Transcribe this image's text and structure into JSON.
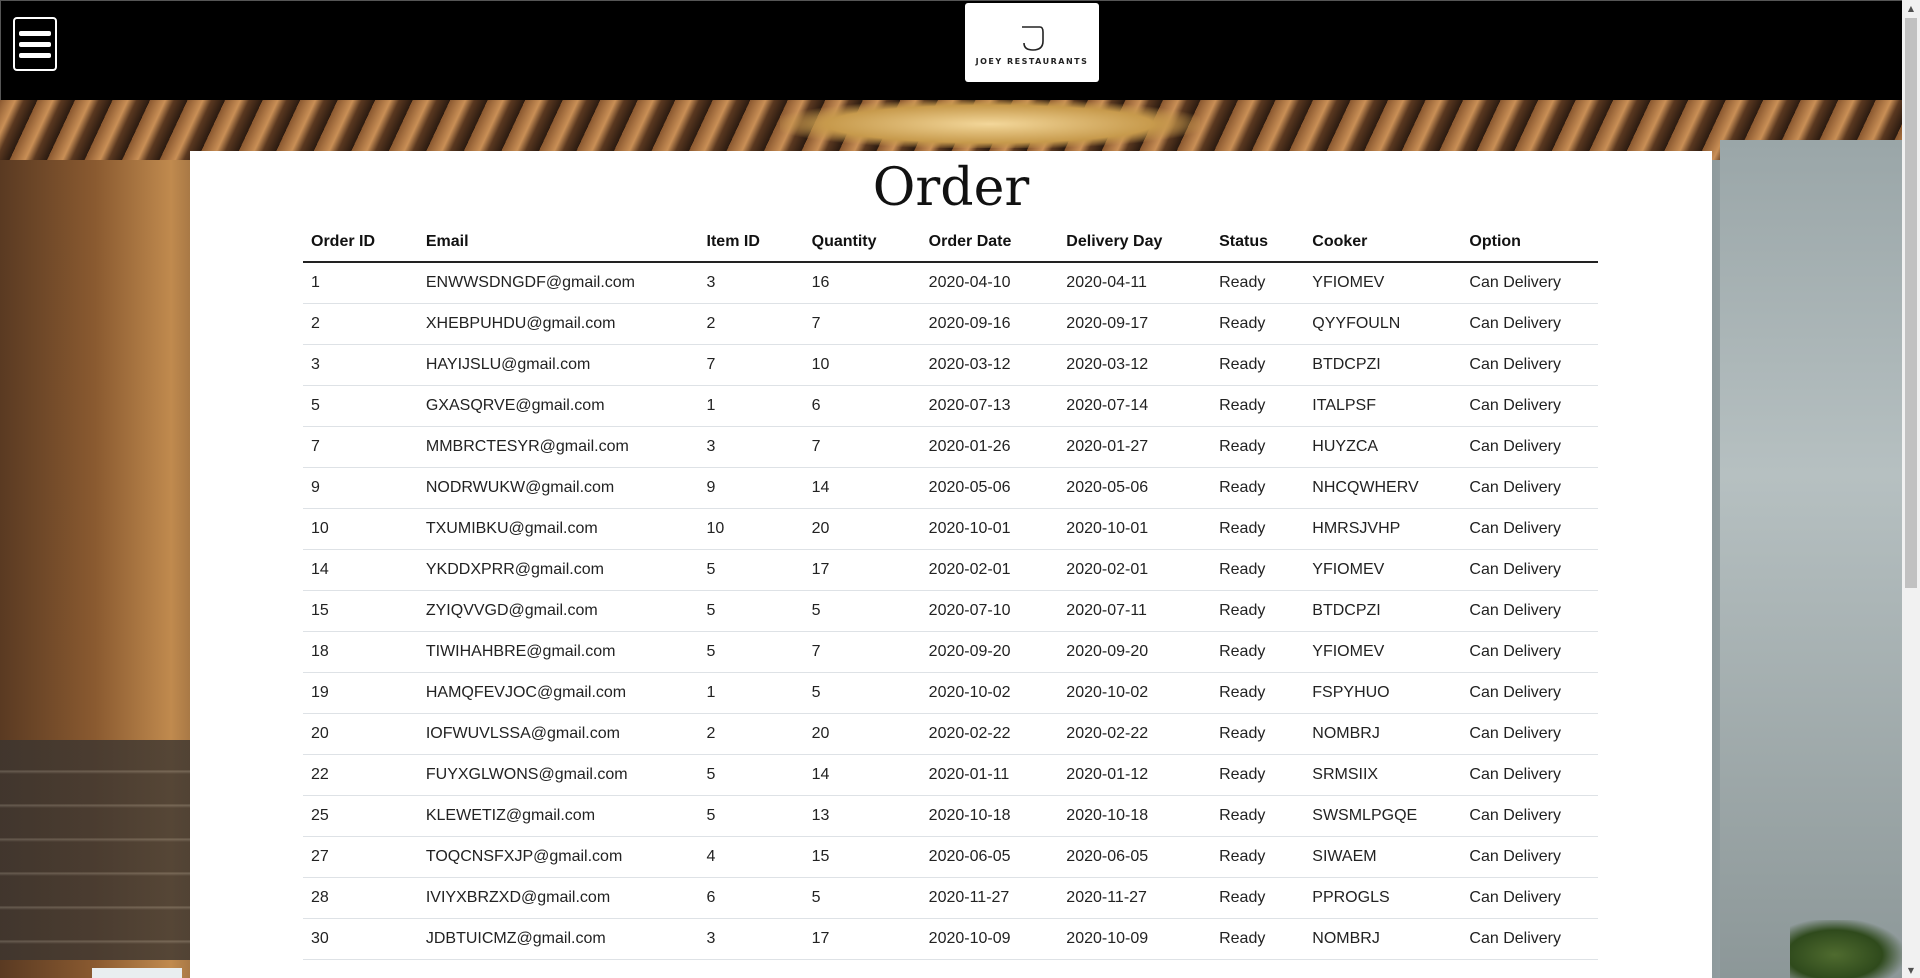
{
  "header": {
    "logo_text": "JOEY RESTAURANTS",
    "menu_icon": "hamburger-icon"
  },
  "page": {
    "title": "Order"
  },
  "table": {
    "columns": [
      "Order ID",
      "Email",
      "Item ID",
      "Quantity",
      "Order Date",
      "Delivery Day",
      "Status",
      "Cooker",
      "Option"
    ],
    "rows": [
      [
        "1",
        "ENWWSDNGDF@gmail.com",
        "3",
        "16",
        "2020-04-10",
        "2020-04-11",
        "Ready",
        "YFIOMEV",
        "Can Delivery"
      ],
      [
        "2",
        "XHEBPUHDU@gmail.com",
        "2",
        "7",
        "2020-09-16",
        "2020-09-17",
        "Ready",
        "QYYFOULN",
        "Can Delivery"
      ],
      [
        "3",
        "HAYIJSLU@gmail.com",
        "7",
        "10",
        "2020-03-12",
        "2020-03-12",
        "Ready",
        "BTDCPZI",
        "Can Delivery"
      ],
      [
        "5",
        "GXASQRVE@gmail.com",
        "1",
        "6",
        "2020-07-13",
        "2020-07-14",
        "Ready",
        "ITALPSF",
        "Can Delivery"
      ],
      [
        "7",
        "MMBRCTESYR@gmail.com",
        "3",
        "7",
        "2020-01-26",
        "2020-01-27",
        "Ready",
        "HUYZCA",
        "Can Delivery"
      ],
      [
        "9",
        "NODRWUKW@gmail.com",
        "9",
        "14",
        "2020-05-06",
        "2020-05-06",
        "Ready",
        "NHCQWHERV",
        "Can Delivery"
      ],
      [
        "10",
        "TXUMIBKU@gmail.com",
        "10",
        "20",
        "2020-10-01",
        "2020-10-01",
        "Ready",
        "HMRSJVHP",
        "Can Delivery"
      ],
      [
        "14",
        "YKDDXPRR@gmail.com",
        "5",
        "17",
        "2020-02-01",
        "2020-02-01",
        "Ready",
        "YFIOMEV",
        "Can Delivery"
      ],
      [
        "15",
        "ZYIQVVGD@gmail.com",
        "5",
        "5",
        "2020-07-10",
        "2020-07-11",
        "Ready",
        "BTDCPZI",
        "Can Delivery"
      ],
      [
        "18",
        "TIWIHAHBRE@gmail.com",
        "5",
        "7",
        "2020-09-20",
        "2020-09-20",
        "Ready",
        "YFIOMEV",
        "Can Delivery"
      ],
      [
        "19",
        "HAMQFEVJOC@gmail.com",
        "1",
        "5",
        "2020-10-02",
        "2020-10-02",
        "Ready",
        "FSPYHUO",
        "Can Delivery"
      ],
      [
        "20",
        "IOFWUVLSSA@gmail.com",
        "2",
        "20",
        "2020-02-22",
        "2020-02-22",
        "Ready",
        "NOMBRJ",
        "Can Delivery"
      ],
      [
        "22",
        "FUYXGLWONS@gmail.com",
        "5",
        "14",
        "2020-01-11",
        "2020-01-12",
        "Ready",
        "SRMSIIX",
        "Can Delivery"
      ],
      [
        "25",
        "KLEWETIZ@gmail.com",
        "5",
        "13",
        "2020-10-18",
        "2020-10-18",
        "Ready",
        "SWSMLPGQE",
        "Can Delivery"
      ],
      [
        "27",
        "TOQCNSFXJP@gmail.com",
        "4",
        "15",
        "2020-06-05",
        "2020-06-05",
        "Ready",
        "SIWAEM",
        "Can Delivery"
      ],
      [
        "28",
        "IVIYXBRZXD@gmail.com",
        "6",
        "5",
        "2020-11-27",
        "2020-11-27",
        "Ready",
        "PPROGLS",
        "Can Delivery"
      ],
      [
        "30",
        "JDBTUICMZ@gmail.com",
        "3",
        "17",
        "2020-10-09",
        "2020-10-09",
        "Ready",
        "NOMBRJ",
        "Can Delivery"
      ]
    ]
  },
  "colors": {
    "header_bg": "#000000",
    "panel_bg": "#ffffff",
    "text": "#222222",
    "row_border": "#dee2e6"
  }
}
